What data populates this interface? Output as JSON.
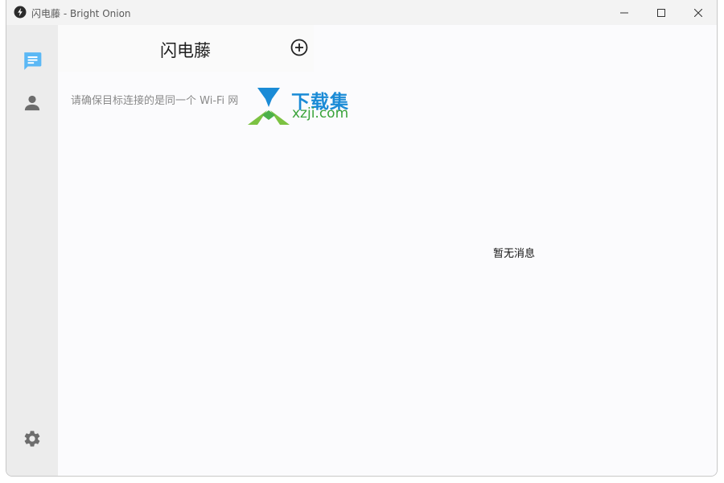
{
  "window": {
    "title": "闪电藤 - Bright Onion"
  },
  "sidebar": {
    "items": [
      {
        "icon": "chat-icon",
        "active": true
      },
      {
        "icon": "contact-icon",
        "active": false
      }
    ],
    "settings_icon": "gear-icon"
  },
  "header": {
    "title": "闪电藤",
    "add_icon": "add-circle-icon"
  },
  "main": {
    "hint": "请确保目标连接的是同一个 Wi-Fi 网",
    "empty_message": "暂无消息"
  },
  "watermark": {
    "cn": "下载集",
    "en": "xzji.com"
  },
  "colors": {
    "accent": "#5bb8f5",
    "icon_gray": "#6d6d6d",
    "sidebar_bg": "#ececec",
    "content_bg": "#fbfbfd",
    "watermark_blue": "#1b8bd6",
    "watermark_green": "#3aa33a"
  }
}
